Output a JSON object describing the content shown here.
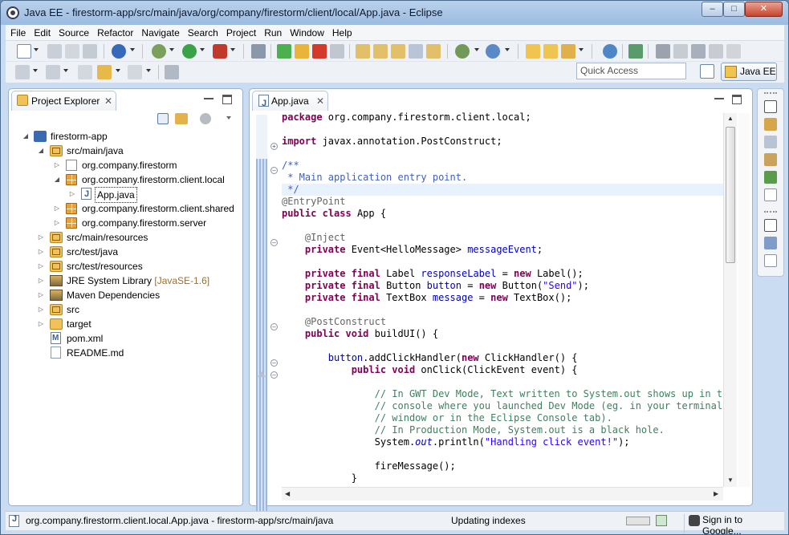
{
  "window": {
    "title": "Java EE - firestorm-app/src/main/java/org/company/firestorm/client/local/App.java - Eclipse",
    "min_glyph": "–",
    "max_glyph": "□",
    "close_glyph": "✕"
  },
  "menu": [
    "File",
    "Edit",
    "Source",
    "Refactor",
    "Navigate",
    "Search",
    "Project",
    "Run",
    "Window",
    "Help"
  ],
  "toolbar": {
    "quick_access_placeholder": "Quick Access",
    "perspective_label": "Java EE"
  },
  "project_explorer": {
    "tab_label": "Project Explorer",
    "tab_close": "✕",
    "items": [
      {
        "label": "firestorm-app",
        "decoration": ""
      },
      {
        "label": "src/main/java",
        "decoration": ""
      },
      {
        "label": "org.company.firestorm",
        "decoration": ""
      },
      {
        "label": "org.company.firestorm.client.local",
        "decoration": ""
      },
      {
        "label": "App.java",
        "decoration": ""
      },
      {
        "label": "org.company.firestorm.client.shared",
        "decoration": ""
      },
      {
        "label": "org.company.firestorm.server",
        "decoration": ""
      },
      {
        "label": "src/main/resources",
        "decoration": ""
      },
      {
        "label": "src/test/java",
        "decoration": ""
      },
      {
        "label": "src/test/resources",
        "decoration": ""
      },
      {
        "label": "JRE System Library",
        "decoration": "[JavaSE-1.6]"
      },
      {
        "label": "Maven Dependencies",
        "decoration": ""
      },
      {
        "label": "src",
        "decoration": ""
      },
      {
        "label": "target",
        "decoration": ""
      },
      {
        "label": "pom.xml",
        "decoration": ""
      },
      {
        "label": "README.md",
        "decoration": ""
      }
    ]
  },
  "editor": {
    "tab_label": "App.java",
    "tab_close": "✕",
    "code_lines": [
      "package org.company.firestorm.client.local;",
      "",
      "import javax.annotation.PostConstruct;",
      "",
      "/**",
      " * Main application entry point.",
      " */",
      "@EntryPoint",
      "public class App {",
      "",
      "    @Inject",
      "    private Event<HelloMessage> messageEvent;",
      "",
      "    private final Label responseLabel = new Label();",
      "    private final Button button = new Button(\"Send\");",
      "    private final TextBox message = new TextBox();",
      "",
      "    @PostConstruct",
      "    public void buildUI() {",
      "",
      "        button.addClickHandler(new ClickHandler() {",
      "            public void onClick(ClickEvent event) {",
      "",
      "                // In GWT Dev Mode, Text written to System.out shows up in the",
      "                // console where you launched Dev Mode (eg. in your terminal",
      "                // window or in the Eclipse Console tab).",
      "                // In Production Mode, System.out is a black hole.",
      "                System.out.println(\"Handling click event!\");",
      "",
      "                fireMessage();",
      "            }"
    ]
  },
  "status": {
    "path": "org.company.firestorm.client.local.App.java - firestorm-app/src/main/java",
    "progress_text": "Updating indexes",
    "signin": "Sign in to Google..."
  }
}
